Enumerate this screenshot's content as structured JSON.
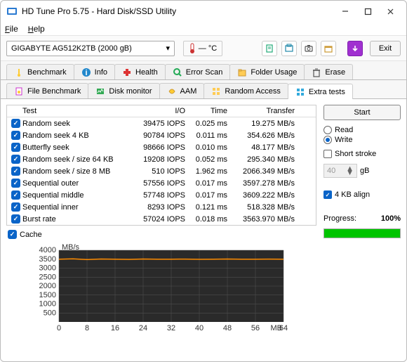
{
  "window": {
    "title": "HD Tune Pro 5.75 - Hard Disk/SSD Utility"
  },
  "menu": {
    "file": "File",
    "help": "Help"
  },
  "drive": {
    "selected": "GIGABYTE AG512K2TB (2000 gB)"
  },
  "temp": {
    "value": "— °C"
  },
  "exit": "Exit",
  "tabs": {
    "row1": [
      "Benchmark",
      "Info",
      "Health",
      "Error Scan",
      "Folder Usage",
      "Erase"
    ],
    "row2": [
      "File Benchmark",
      "Disk monitor",
      "AAM",
      "Random Access",
      "Extra tests"
    ]
  },
  "active_tab": "Extra tests",
  "table": {
    "headers": [
      "Test",
      "I/O",
      "Time",
      "Transfer"
    ],
    "rows": [
      {
        "name": "Random seek",
        "io": "39475 IOPS",
        "time": "0.025 ms",
        "xfer": "19.275 MB/s"
      },
      {
        "name": "Random seek 4 KB",
        "io": "90784 IOPS",
        "time": "0.011 ms",
        "xfer": "354.626 MB/s"
      },
      {
        "name": "Butterfly seek",
        "io": "98666 IOPS",
        "time": "0.010 ms",
        "xfer": "48.177 MB/s"
      },
      {
        "name": "Random seek / size 64 KB",
        "io": "19208 IOPS",
        "time": "0.052 ms",
        "xfer": "295.340 MB/s"
      },
      {
        "name": "Random seek / size 8 MB",
        "io": "510 IOPS",
        "time": "1.962 ms",
        "xfer": "2066.349 MB/s"
      },
      {
        "name": "Sequential outer",
        "io": "57556 IOPS",
        "time": "0.017 ms",
        "xfer": "3597.278 MB/s"
      },
      {
        "name": "Sequential middle",
        "io": "57748 IOPS",
        "time": "0.017 ms",
        "xfer": "3609.222 MB/s"
      },
      {
        "name": "Sequential inner",
        "io": "8293 IOPS",
        "time": "0.121 ms",
        "xfer": "518.328 MB/s"
      },
      {
        "name": "Burst rate",
        "io": "57024 IOPS",
        "time": "0.018 ms",
        "xfer": "3563.970 MB/s"
      }
    ]
  },
  "cache": "Cache",
  "side": {
    "start": "Start",
    "read": "Read",
    "write": "Write",
    "short_stroke": "Short stroke",
    "stroke_value": "40",
    "stroke_unit": "gB",
    "align": "4 KB align",
    "progress_label": "Progress:",
    "progress_value": "100%"
  },
  "chart_data": {
    "type": "line",
    "title": "",
    "xlabel": "MB",
    "ylabel": "MB/s",
    "xlim": [
      0,
      64
    ],
    "ylim": [
      0,
      4000
    ],
    "x_ticks": [
      0,
      8,
      16,
      24,
      32,
      40,
      48,
      56,
      64
    ],
    "y_ticks": [
      500,
      1000,
      1500,
      2000,
      2500,
      3000,
      3500,
      4000
    ],
    "series": [
      {
        "name": "Transfer",
        "color": "#ff8c00",
        "approx_value": 3500,
        "x": [
          0,
          4,
          8,
          12,
          16,
          20,
          24,
          28,
          32,
          36,
          40,
          44,
          48,
          52,
          56,
          60,
          64
        ],
        "values": [
          3500,
          3520,
          3480,
          3510,
          3500,
          3490,
          3510,
          3500,
          3500,
          3505,
          3495,
          3500,
          3510,
          3500,
          3500,
          3505,
          3500
        ]
      }
    ]
  }
}
